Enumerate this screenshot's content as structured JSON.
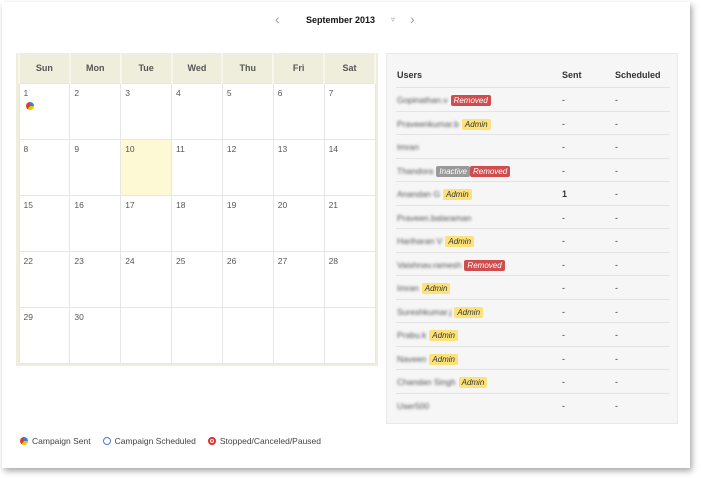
{
  "nav": {
    "prev": "‹",
    "title": "September 2013",
    "dropdown": "▿",
    "next": "›"
  },
  "calendar": {
    "weekdays": [
      "Sun",
      "Mon",
      "Tue",
      "Wed",
      "Thu",
      "Fri",
      "Sat"
    ],
    "weeks": [
      [
        "1",
        "2",
        "3",
        "4",
        "5",
        "6",
        "7"
      ],
      [
        "8",
        "9",
        "10",
        "11",
        "12",
        "13",
        "14"
      ],
      [
        "15",
        "16",
        "17",
        "18",
        "19",
        "20",
        "21"
      ],
      [
        "22",
        "23",
        "24",
        "25",
        "26",
        "27",
        "28"
      ],
      [
        "29",
        "30",
        "",
        "",
        "",
        "",
        ""
      ]
    ],
    "today": "10",
    "campaign_sent_days": [
      "1"
    ]
  },
  "users_table": {
    "headers": {
      "users": "Users",
      "sent": "Sent",
      "scheduled": "Scheduled"
    },
    "rows": [
      {
        "name": "Gopinathan.v",
        "badges": [
          "Removed"
        ],
        "sent": "-",
        "scheduled": "-"
      },
      {
        "name": "Praveenkumar.b",
        "badges": [
          "Admin"
        ],
        "sent": "-",
        "scheduled": "-"
      },
      {
        "name": "Imran",
        "badges": [],
        "sent": "-",
        "scheduled": "-"
      },
      {
        "name": "Thandora",
        "badges": [
          "Inactive",
          "Removed"
        ],
        "sent": "-",
        "scheduled": "-"
      },
      {
        "name": "Anandan G",
        "badges": [
          "Admin"
        ],
        "sent": "1",
        "scheduled": "-"
      },
      {
        "name": "Praveen.balaraman",
        "badges": [],
        "sent": "-",
        "scheduled": "-"
      },
      {
        "name": "Hariharan V",
        "badges": [
          "Admin"
        ],
        "sent": "-",
        "scheduled": "-"
      },
      {
        "name": "Vaishnav.ramesh",
        "badges": [
          "Removed"
        ],
        "sent": "-",
        "scheduled": "-"
      },
      {
        "name": "Imran",
        "badges": [
          "Admin"
        ],
        "sent": "-",
        "scheduled": "-"
      },
      {
        "name": "Sureshkumar.j",
        "badges": [
          "Admin"
        ],
        "sent": "-",
        "scheduled": "-"
      },
      {
        "name": "Prabu.k",
        "badges": [
          "Admin"
        ],
        "sent": "-",
        "scheduled": "-"
      },
      {
        "name": "Naveen",
        "badges": [
          "Admin"
        ],
        "sent": "-",
        "scheduled": "-"
      },
      {
        "name": "Chandan Singh",
        "badges": [
          "Admin"
        ],
        "sent": "-",
        "scheduled": "-"
      },
      {
        "name": "User500",
        "badges": [],
        "sent": "-",
        "scheduled": "-"
      }
    ]
  },
  "legend": [
    {
      "icon": "campaign-sent-icon",
      "label": "Campaign Sent"
    },
    {
      "icon": "campaign-scheduled-icon",
      "label": "Campaign Scheduled"
    },
    {
      "icon": "stopped-icon",
      "label": "Stopped/Canceled/Paused"
    }
  ],
  "colors": {
    "removed": "#d04d4f",
    "admin": "#fde27a",
    "inactive": "#999999",
    "today": "#fdf9d4",
    "header": "#efeedd"
  }
}
